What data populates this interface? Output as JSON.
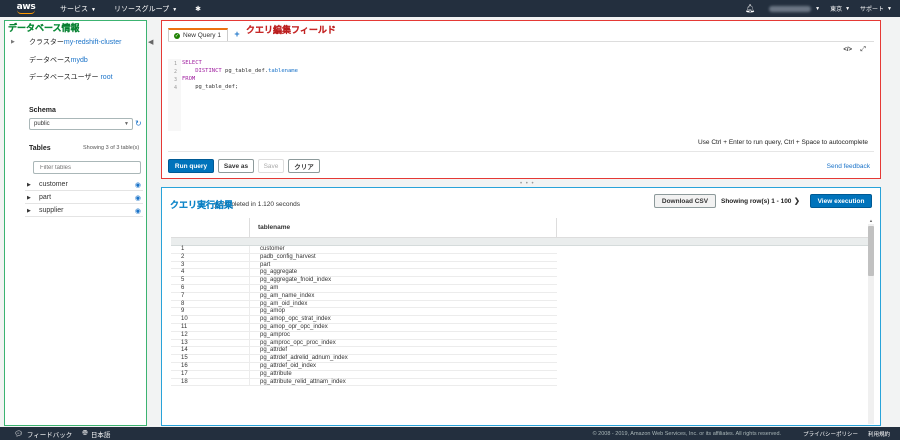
{
  "nav": {
    "logo": "aws",
    "services": "サービス",
    "resource_groups": "リソースグループ",
    "region": "東京",
    "support": "サポート"
  },
  "left": {
    "annotation": "データベース情報",
    "cluster_label": "クラスター",
    "cluster_value": "my-redshift-cluster",
    "database_label": "データベース",
    "database_value": "mydb",
    "user_label": "データベースユーザー",
    "user_value": "root",
    "schema_label": "Schema",
    "schema_value": "public",
    "tables_label": "Tables",
    "tables_count": "Showing 3 of 3 table(s)",
    "filter_placeholder": "Filter tables",
    "tables": [
      "customer",
      "part",
      "supplier"
    ]
  },
  "editor": {
    "annotation": "クエリ編集フィールド",
    "tab_label": "New Query 1",
    "tab_add": "+",
    "code": {
      "l1": "SELECT",
      "l2_kw": "DISTINCT",
      "l2_a": " pg_table_def.",
      "l2_b": "tablename",
      "l3": "FROM",
      "l4": "    pg_table_def;"
    },
    "line_numbers": [
      "1",
      "2",
      "3",
      "4"
    ],
    "hint": "Use Ctrl + Enter to run query, Ctrl + Space to autocomplete",
    "run_label": "Run query",
    "save_as_label": "Save as",
    "save_label": "Save",
    "clear_label": "クリア",
    "feedback_label": "Send feedback"
  },
  "results": {
    "annotation": "クエリ実行結果",
    "status": "y completed in 1.120 seconds",
    "download_label": "Download CSV",
    "rows_label": "Showing row(s) 1 - 100",
    "exec_label": "View execution",
    "column": "tablename",
    "rows": [
      [
        "1",
        "customer"
      ],
      [
        "2",
        "padb_config_harvest"
      ],
      [
        "3",
        "part"
      ],
      [
        "4",
        "pg_aggregate"
      ],
      [
        "5",
        "pg_aggregate_fnoid_index"
      ],
      [
        "6",
        "pg_am"
      ],
      [
        "7",
        "pg_am_name_index"
      ],
      [
        "8",
        "pg_am_oid_index"
      ],
      [
        "9",
        "pg_amop"
      ],
      [
        "10",
        "pg_amop_opc_strat_index"
      ],
      [
        "11",
        "pg_amop_opr_opc_index"
      ],
      [
        "12",
        "pg_amproc"
      ],
      [
        "13",
        "pg_amproc_opc_proc_index"
      ],
      [
        "14",
        "pg_attrdef"
      ],
      [
        "15",
        "pg_attrdef_adrelid_adnum_index"
      ],
      [
        "16",
        "pg_attrdef_oid_index"
      ],
      [
        "17",
        "pg_attribute"
      ],
      [
        "18",
        "pg_attribute_relid_attnam_index"
      ]
    ]
  },
  "footer": {
    "feedback": "フィードバック",
    "language": "日本語",
    "copyright": "© 2008 - 2019, Amazon Web Services, Inc. or its affiliates. All rights reserved.",
    "privacy": "プライバシーポリシー",
    "terms": "利用規約"
  },
  "colors": {
    "nav_bg": "#232f3e",
    "accent": "#ff9900",
    "primary": "#0073bb",
    "annotation_green": "#00c853",
    "annotation_red": "#ff4d4d",
    "annotation_blue": "#4fc3f7"
  }
}
